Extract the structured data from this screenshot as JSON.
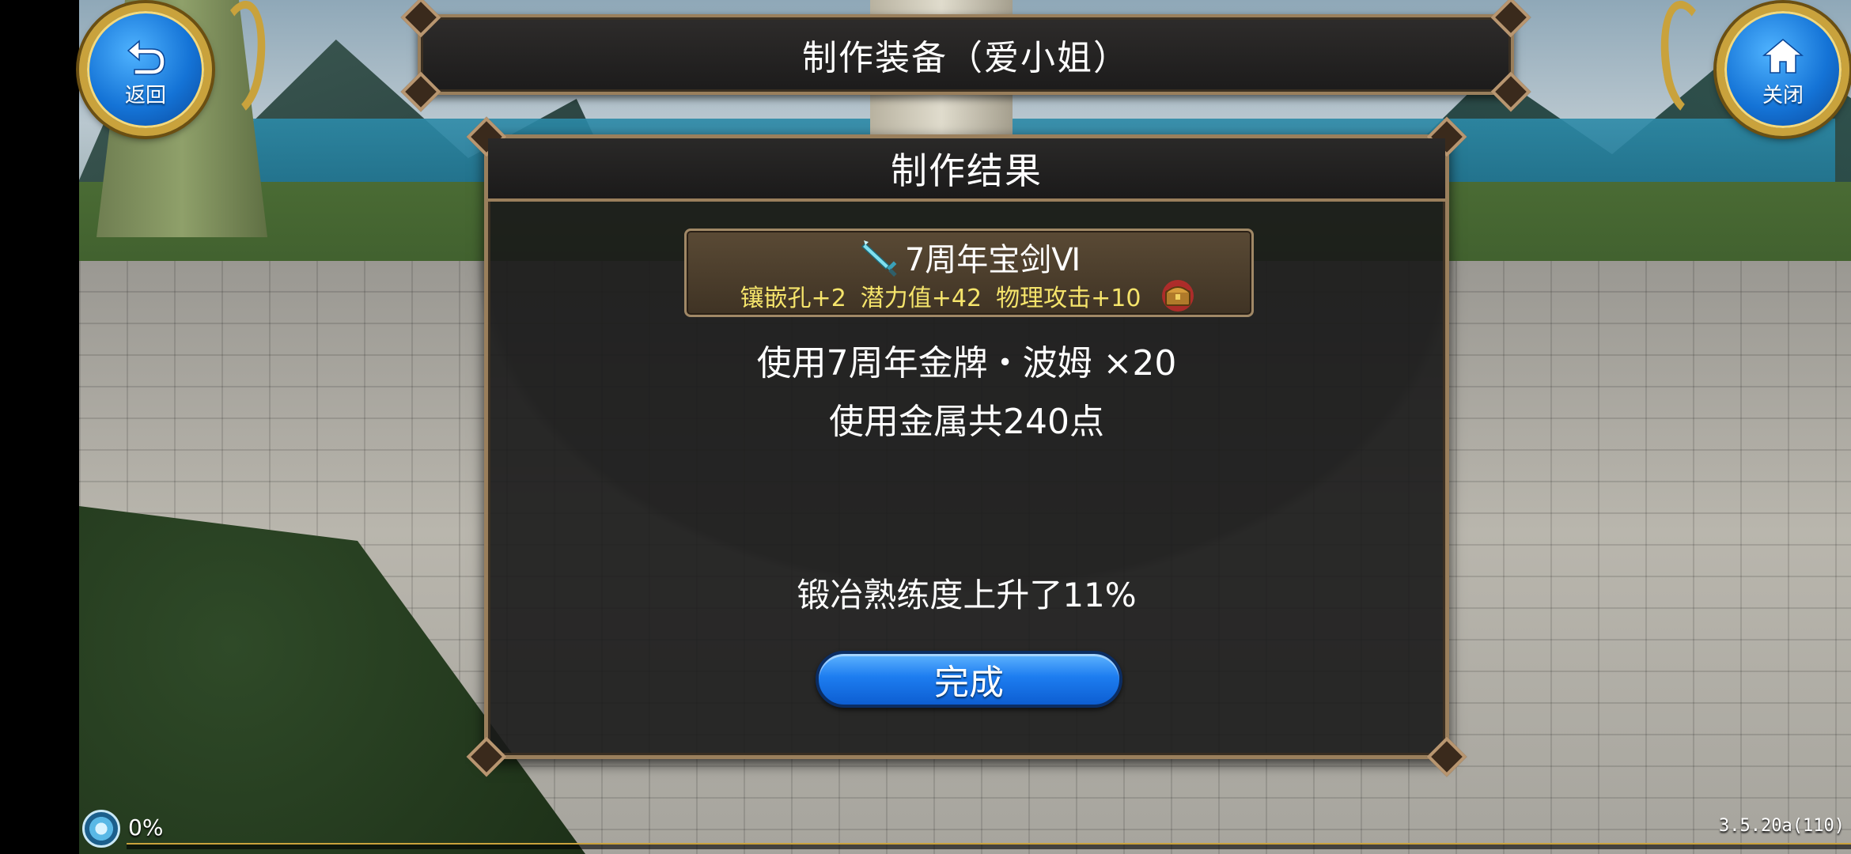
{
  "header": {
    "title": "制作装备（爱小姐）",
    "back_label": "返回",
    "close_label": "关闭"
  },
  "panel": {
    "title": "制作结果",
    "item": {
      "name": "7周年宝剑Ⅵ",
      "stats": [
        "镶嵌孔+2",
        "潜力值+42",
        "物理攻击+10"
      ],
      "icon": "sword-icon",
      "extra_icon": "treasure-chest-icon"
    },
    "material_line": "使用7周年金牌・波姆 ×20",
    "metal_line": "使用金属共240点",
    "skill_line": "锻冶熟练度上升了11%",
    "done_label": "完成"
  },
  "hud": {
    "progress_percent": "0%",
    "progress_value": 0,
    "version": "3.5.20a(110)"
  },
  "colors": {
    "panel_border": "#9a7f5c",
    "stat_text": "#f5e46b",
    "button_blue": "#1d7df0",
    "corner_gold": "#c9a23c"
  }
}
